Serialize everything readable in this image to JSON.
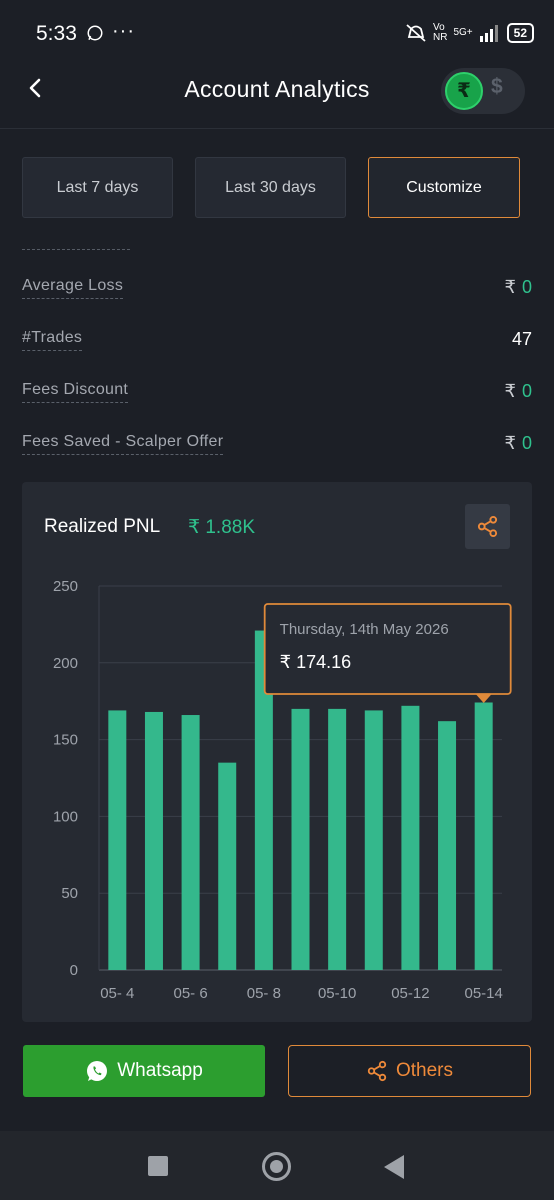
{
  "status_bar": {
    "time": "5:33",
    "network": "5G+",
    "battery": "52"
  },
  "header": {
    "title": "Account Analytics",
    "currency_active": "₹",
    "currency_inactive": "$"
  },
  "range_buttons": [
    {
      "label": "Last 7 days",
      "active": false
    },
    {
      "label": "Last 30 days",
      "active": false
    },
    {
      "label": "Customize",
      "active": true
    }
  ],
  "stats": [
    {
      "label": "Average Loss",
      "symbol": "₹",
      "value": "0"
    },
    {
      "label": "#Trades",
      "symbol": "",
      "value": "47"
    },
    {
      "label": "Fees Discount",
      "symbol": "₹",
      "value": "0"
    },
    {
      "label": "Fees Saved - Scalper Offer",
      "symbol": "₹",
      "value": "0"
    }
  ],
  "card": {
    "title": "Realized PNL",
    "total": "₹ 1.88K"
  },
  "tooltip": {
    "date": "Thursday, 14th May 2026",
    "symbol": "₹",
    "value": "174.16"
  },
  "chart_data": {
    "type": "bar",
    "yticks": [
      "250",
      "200",
      "150",
      "100",
      "50",
      "0"
    ],
    "ylim": [
      0,
      250
    ],
    "xtick_labels": [
      "05- 4",
      "05- 6",
      "05- 8",
      "05-10",
      "05-12",
      "05-14"
    ],
    "categories": [
      "05- 4",
      "05- 5",
      "05- 6",
      "05- 7",
      "05- 8",
      "05- 9",
      "05-10",
      "05-11",
      "05-12",
      "05-13",
      "05-14"
    ],
    "values": [
      169,
      168,
      166,
      135,
      221,
      170,
      170,
      169,
      172,
      162,
      174.16
    ],
    "highlight_index": 10,
    "bar_color": "#34b88c"
  },
  "buttons": {
    "whatsapp": "Whatsapp",
    "others": "Others"
  },
  "colors": {
    "accent": "#e08a3a",
    "green": "#2fc18d",
    "background": "#1c1f26"
  }
}
